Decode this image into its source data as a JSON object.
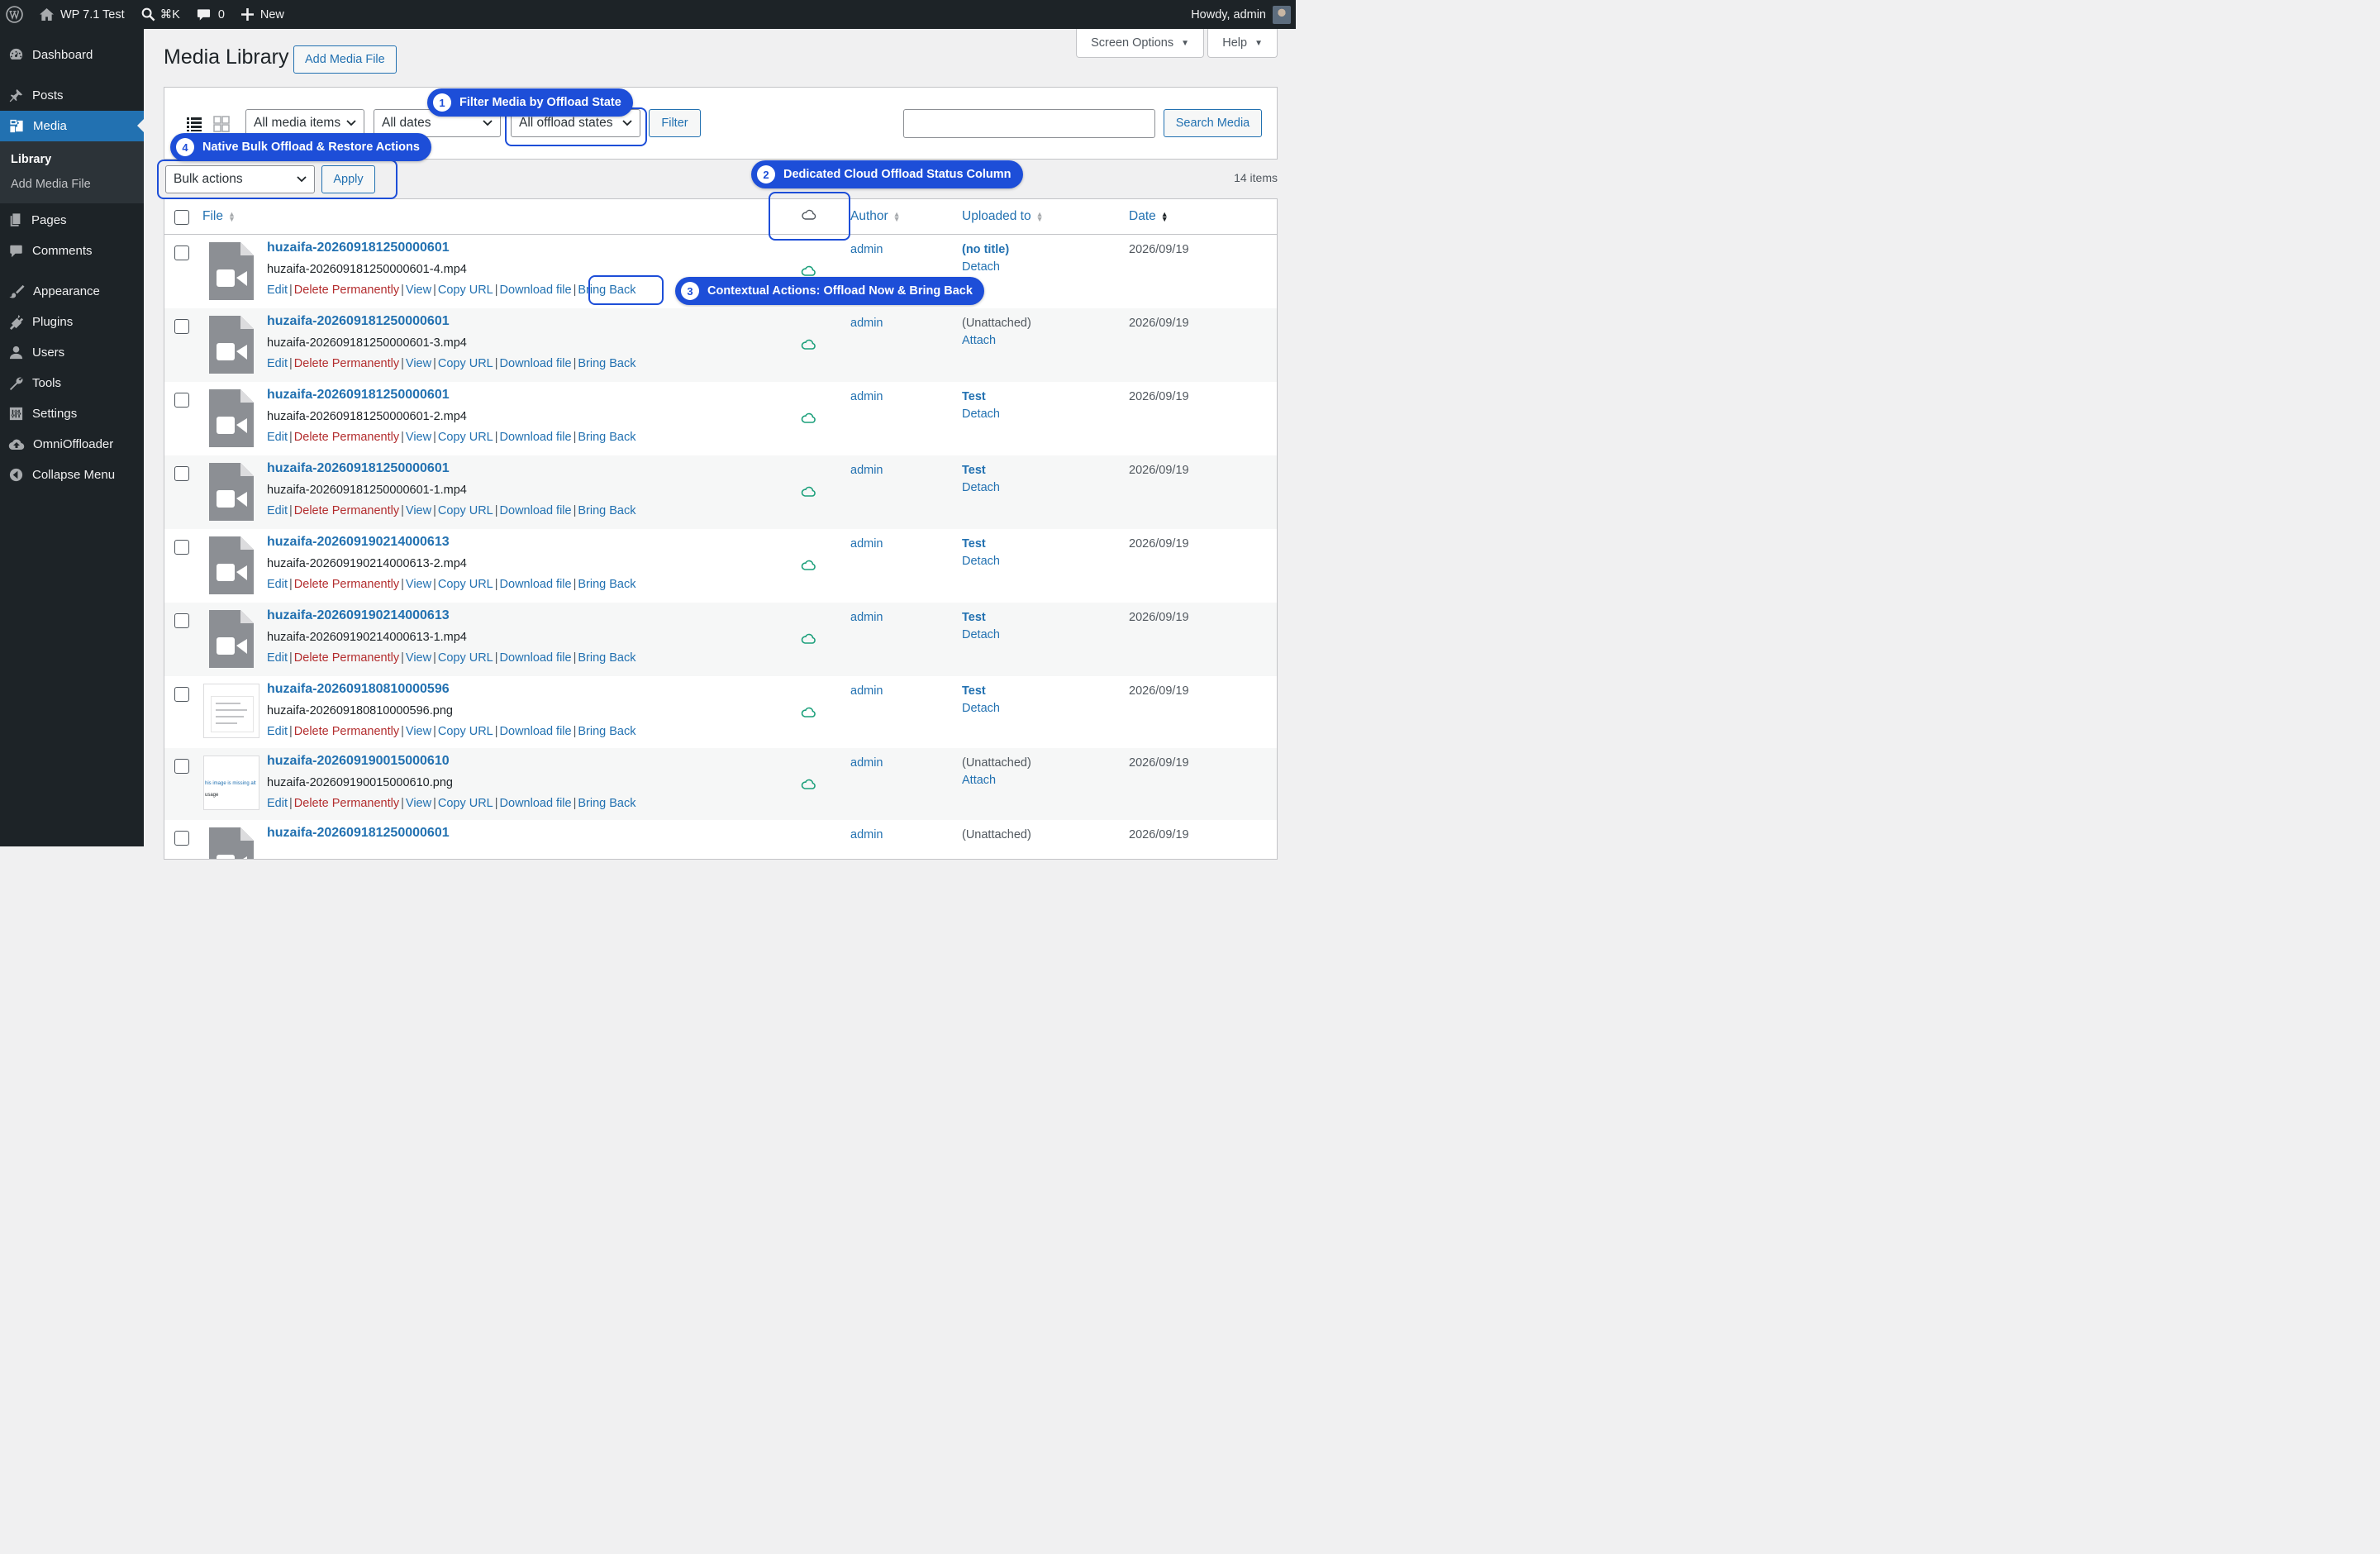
{
  "adminbar": {
    "site_name": "WP 7.1 Test",
    "search_shortcut": "⌘K",
    "comments_count": "0",
    "new_label": "New",
    "howdy": "Howdy, admin"
  },
  "sidebar": {
    "items": [
      {
        "label": "Dashboard",
        "icon": "dashboard-icon"
      },
      {
        "label": "Posts",
        "icon": "pin-icon"
      },
      {
        "label": "Media",
        "icon": "media-icon"
      },
      {
        "label": "Pages",
        "icon": "page-icon"
      },
      {
        "label": "Comments",
        "icon": "comment-icon"
      },
      {
        "label": "Appearance",
        "icon": "brush-icon"
      },
      {
        "label": "Plugins",
        "icon": "plug-icon"
      },
      {
        "label": "Users",
        "icon": "user-icon"
      },
      {
        "label": "Tools",
        "icon": "wrench-icon"
      },
      {
        "label": "Settings",
        "icon": "sliders-icon"
      },
      {
        "label": "OmniOffloader",
        "icon": "cloud-upload-icon"
      },
      {
        "label": "Collapse Menu",
        "icon": "collapse-icon"
      }
    ],
    "media_submenu": [
      "Library",
      "Add Media File"
    ]
  },
  "header": {
    "screen_options": "Screen Options",
    "help": "Help",
    "title": "Media Library",
    "add_new": "Add Media File"
  },
  "filters": {
    "media_type": "All media items",
    "dates": "All dates",
    "offload_state": "All offload states",
    "filter_button": "Filter",
    "search_button": "Search Media",
    "search_value": ""
  },
  "bulk": {
    "select": "Bulk actions",
    "apply": "Apply"
  },
  "items_count": "14 items",
  "columns": {
    "file": "File",
    "author": "Author",
    "uploaded_to": "Uploaded to",
    "date": "Date"
  },
  "row_actions": {
    "edit": "Edit",
    "delete": "Delete Permanently",
    "view": "View",
    "copy_url": "Copy URL",
    "download": "Download file",
    "bring_back": "Bring Back"
  },
  "rows": [
    {
      "title": "huzaifa-20260918125000060​1",
      "filename": "huzaifa-202609181250000601-4.mp4",
      "author": "admin",
      "uploaded_to": "(no title)",
      "uploaded_action": "Detach",
      "date": "2026/09/19",
      "type": "video"
    },
    {
      "title": "huzaifa-202609181250000601",
      "filename": "huzaifa-202609181250000601-3.mp4",
      "author": "admin",
      "uploaded_to": "(Unattached)",
      "uploaded_action": "Attach",
      "date": "2026/09/19",
      "type": "video"
    },
    {
      "title": "huzaifa-202609181250000601",
      "filename": "huzaifa-202609181250000601-2.mp4",
      "author": "admin",
      "uploaded_to": "Test",
      "uploaded_action": "Detach",
      "date": "2026/09/19",
      "type": "video"
    },
    {
      "title": "huzaifa-202609181250000601",
      "filename": "huzaifa-202609181250000601-1.mp4",
      "author": "admin",
      "uploaded_to": "Test",
      "uploaded_action": "Detach",
      "date": "2026/09/19",
      "type": "video"
    },
    {
      "title": "huzaifa-202609190214000613",
      "filename": "huzaifa-202609190214000613-2.mp4",
      "author": "admin",
      "uploaded_to": "Test",
      "uploaded_action": "Detach",
      "date": "2026/09/19",
      "type": "video"
    },
    {
      "title": "huzaifa-202609190214000613",
      "filename": "huzaifa-202609190214000613-1.mp4",
      "author": "admin",
      "uploaded_to": "Test",
      "uploaded_action": "Detach",
      "date": "2026/09/19",
      "type": "video"
    },
    {
      "title": "huzaifa-202609180810000596",
      "filename": "huzaifa-202609180810000596.png",
      "author": "admin",
      "uploaded_to": "Test",
      "uploaded_action": "Detach",
      "date": "2026/09/19",
      "type": "screenshot"
    },
    {
      "title": "huzaifa-202609190015000610",
      "filename": "huzaifa-202609190015000610.png",
      "author": "admin",
      "uploaded_to": "(Unattached)",
      "uploaded_action": "Attach",
      "date": "2026/09/19",
      "type": "missing",
      "thumb_text_1": "his image is missing alt",
      "thumb_text_2": "usage"
    },
    {
      "title": "huzaifa-202609181250000601",
      "filename": "",
      "author": "admin",
      "uploaded_to": "(Unattached)",
      "uploaded_action": "",
      "date": "2026/09/19",
      "type": "video"
    }
  ],
  "callouts": [
    {
      "num": "1",
      "text": "Filter Media by Offload State"
    },
    {
      "num": "2",
      "text": "Dedicated Cloud Offload Status Column"
    },
    {
      "num": "3",
      "text": "Contextual Actions: Offload Now & Bring Back"
    },
    {
      "num": "4",
      "text": "Native Bulk Offload & Restore Actions"
    }
  ],
  "colors": {
    "accent": "#2271b1",
    "callout": "#1d4ed8",
    "cloud_offloaded": "#1a9f7a",
    "delete": "#b32d2e",
    "adminbar": "#1d2327"
  }
}
